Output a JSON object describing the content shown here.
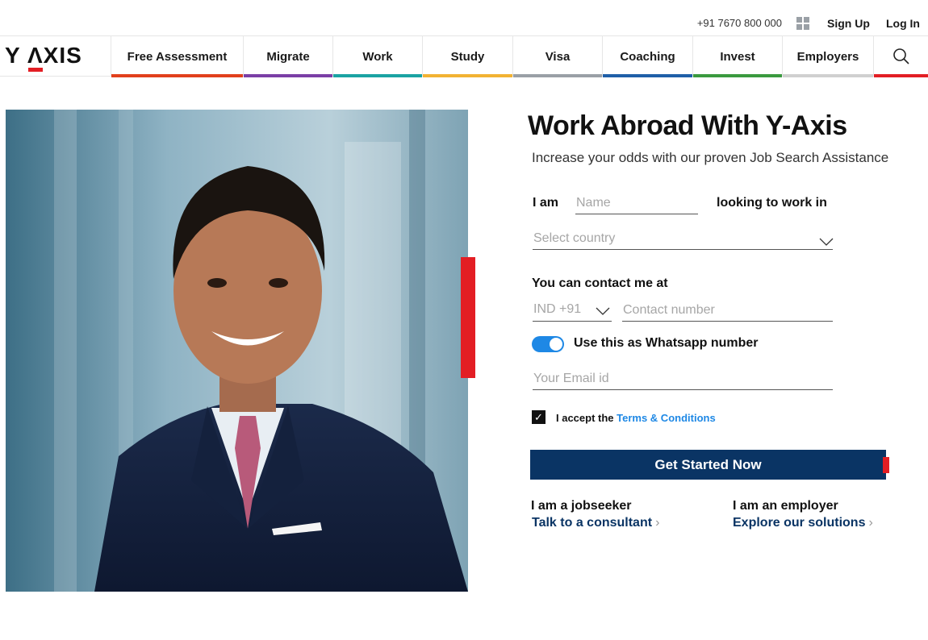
{
  "topbar": {
    "phone": "+91 7670 800 000",
    "apps_icon": "grid-icon",
    "signup_label": "Sign Up",
    "login_label": "Log In"
  },
  "logo": {
    "text_y": "Y ",
    "text_a": "Λ",
    "text_xis": "XIS"
  },
  "nav": {
    "items": [
      {
        "label": "Free Assessment",
        "color": "#e2401c"
      },
      {
        "label": "Migrate",
        "color": "#7b3fa6"
      },
      {
        "label": "Work",
        "color": "#1aa3a3"
      },
      {
        "label": "Study",
        "color": "#f2b233"
      },
      {
        "label": "Visa",
        "color": "#9aa0a6"
      },
      {
        "label": "Coaching",
        "color": "#1f5fa8"
      },
      {
        "label": "Invest",
        "color": "#3a9a3f"
      },
      {
        "label": "Employers",
        "color": "#d0d0d0"
      }
    ],
    "search_icon": "search-icon"
  },
  "form": {
    "title": "Work Abroad With Y-Axis",
    "subtitle": "Increase your odds with our proven Job Search Assistance",
    "i_am_label": "I am",
    "name_placeholder": "Name",
    "looking_label": "looking to work in",
    "country_placeholder": "Select country",
    "contact_label": "You can contact me at",
    "country_code": "IND +91",
    "contact_placeholder": "Contact number",
    "whatsapp_label": "Use this as Whatsapp number",
    "whatsapp_enabled": true,
    "email_placeholder": "Your Email id",
    "accept_prefix": "I accept the ",
    "terms_link": "Terms & Conditions",
    "terms_checked": true,
    "cta_label": "Get Started Now",
    "jobseeker_label": "I am a jobseeker",
    "jobseeker_link": "Talk to a consultant",
    "employer_label": "I am an employer",
    "employer_link": "Explore our solutions"
  },
  "colors": {
    "brand_red": "#e31e24",
    "navy": "#0a3464",
    "toggle_blue": "#1e88e5"
  }
}
